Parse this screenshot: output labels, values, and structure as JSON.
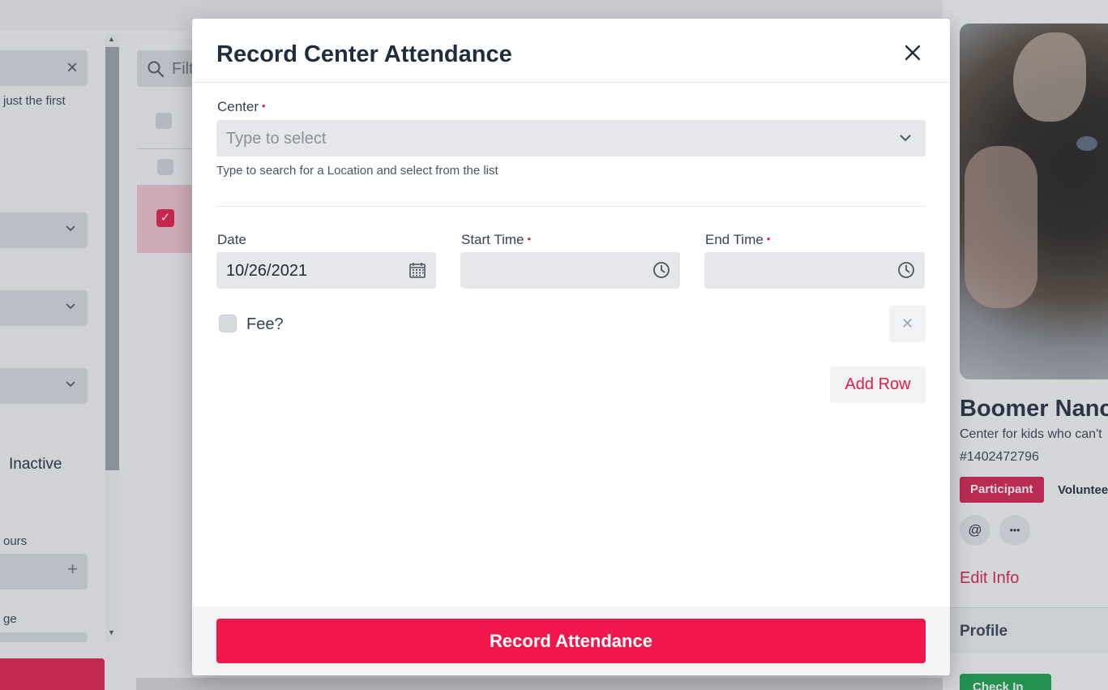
{
  "background": {
    "filters_panel": {
      "hint_text": "just the first",
      "inactive_label": "Inactive",
      "hours_label": "ours",
      "range_label": "ge"
    },
    "list": {
      "filter_placeholder": "Filt"
    },
    "profile": {
      "name": "Boomer Nanc",
      "description": "Center for kids who can't",
      "id": "#1402472796",
      "badge_participant": "Participant",
      "badge_volunteer": "Voluntee",
      "email_icon_glyph": "@",
      "more_icon_glyph": "•••",
      "edit_link": "Edit Info",
      "profile_section": "Profile",
      "green_button": "Check In"
    }
  },
  "modal": {
    "title": "Record Center Attendance",
    "center": {
      "label": "Center",
      "required_marker": "•",
      "placeholder": "Type to select",
      "help": "Type to search for a Location and select from the list"
    },
    "date": {
      "label": "Date",
      "value": "10/26/2021"
    },
    "start_time": {
      "label": "Start Time",
      "required_marker": "•",
      "value": ""
    },
    "end_time": {
      "label": "End Time",
      "required_marker": "•",
      "value": ""
    },
    "fee_label": "Fee?",
    "fee_checked": false,
    "remove_row_glyph": "✕",
    "add_row_label": "Add Row",
    "submit_label": "Record Attendance"
  },
  "colors": {
    "accent": "#e11d48",
    "submit": "#ef174b",
    "title": "#1f2d3d",
    "field_bg": "#e5e7eb"
  }
}
